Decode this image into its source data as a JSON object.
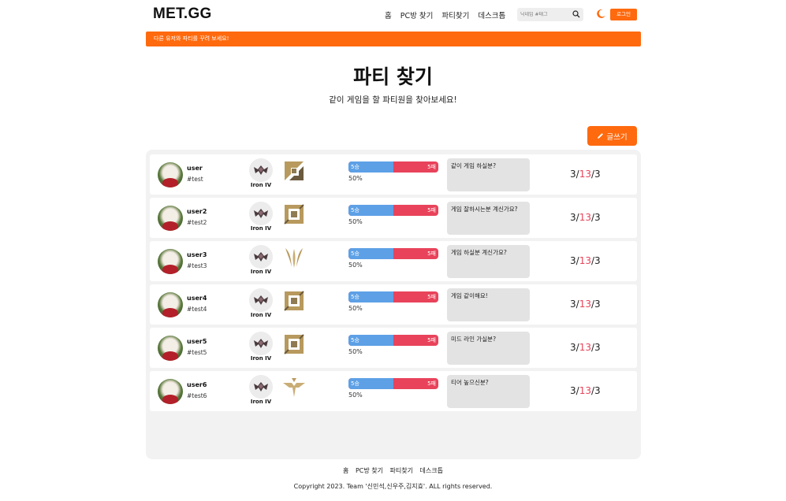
{
  "header": {
    "logo": "MET.GG",
    "nav": [
      "홈",
      "PC방 찾기",
      "파티찾기",
      "데스크톱"
    ],
    "search_placeholder": "닉네임 #태그",
    "login_label": "로그인"
  },
  "banner": {
    "text": "다른 유저와 파티를 꾸려 보세요!"
  },
  "main": {
    "title": "파티 찾기",
    "subtitle": "같이 게임을 할 파티원을 찾아보세요!",
    "write_label": "글쓰기"
  },
  "colors": {
    "accent": "#ff6a0e",
    "win": "#5da0e6",
    "loss": "#e8435a",
    "position_gold": "#b89a5e"
  },
  "rows": [
    {
      "name": "user",
      "tag": "#test",
      "tier": "Iron IV",
      "position_icon": "top-lane-icon",
      "wins": "5승",
      "losses": "5패",
      "win_fraction": 0.5,
      "rate": "50%",
      "memo": "같이 게임 하실분?",
      "count_a": "3",
      "count_b": "13",
      "count_c": "3"
    },
    {
      "name": "user2",
      "tag": "#test2",
      "tier": "Iron IV",
      "position_icon": "mid-lane-icon",
      "wins": "5승",
      "losses": "5패",
      "win_fraction": 0.5,
      "rate": "50%",
      "memo": "게임 잘하시는분 계신가요?",
      "count_a": "3",
      "count_b": "13",
      "count_c": "3"
    },
    {
      "name": "user3",
      "tag": "#test3",
      "tier": "Iron IV",
      "position_icon": "jungle-icon",
      "wins": "5승",
      "losses": "5패",
      "win_fraction": 0.5,
      "rate": "50%",
      "memo": "게임 하실분 계신가요?",
      "count_a": "3",
      "count_b": "13",
      "count_c": "3"
    },
    {
      "name": "user4",
      "tag": "#test4",
      "tier": "Iron IV",
      "position_icon": "mid-lane-icon",
      "wins": "5승",
      "losses": "5패",
      "win_fraction": 0.5,
      "rate": "50%",
      "memo": "게임 같이해요!",
      "count_a": "3",
      "count_b": "13",
      "count_c": "3"
    },
    {
      "name": "user5",
      "tag": "#test5",
      "tier": "Iron IV",
      "position_icon": "mid-lane-icon",
      "wins": "5승",
      "losses": "5패",
      "win_fraction": 0.5,
      "rate": "50%",
      "memo": "미드 라인 가실분?",
      "count_a": "3",
      "count_b": "13",
      "count_c": "3"
    },
    {
      "name": "user6",
      "tag": "#test6",
      "tier": "Iron IV",
      "position_icon": "support-icon",
      "wins": "5승",
      "losses": "5패",
      "win_fraction": 0.5,
      "rate": "50%",
      "memo": "티어 높으신분?",
      "count_a": "3",
      "count_b": "13",
      "count_c": "3"
    }
  ],
  "footer": {
    "nav": [
      "홈",
      "PC방 찾기",
      "파티찾기",
      "데스크톱"
    ],
    "copyright": "Copyright 2023. Team '신민석,신우주,김지효'. ALL rights reserved."
  }
}
